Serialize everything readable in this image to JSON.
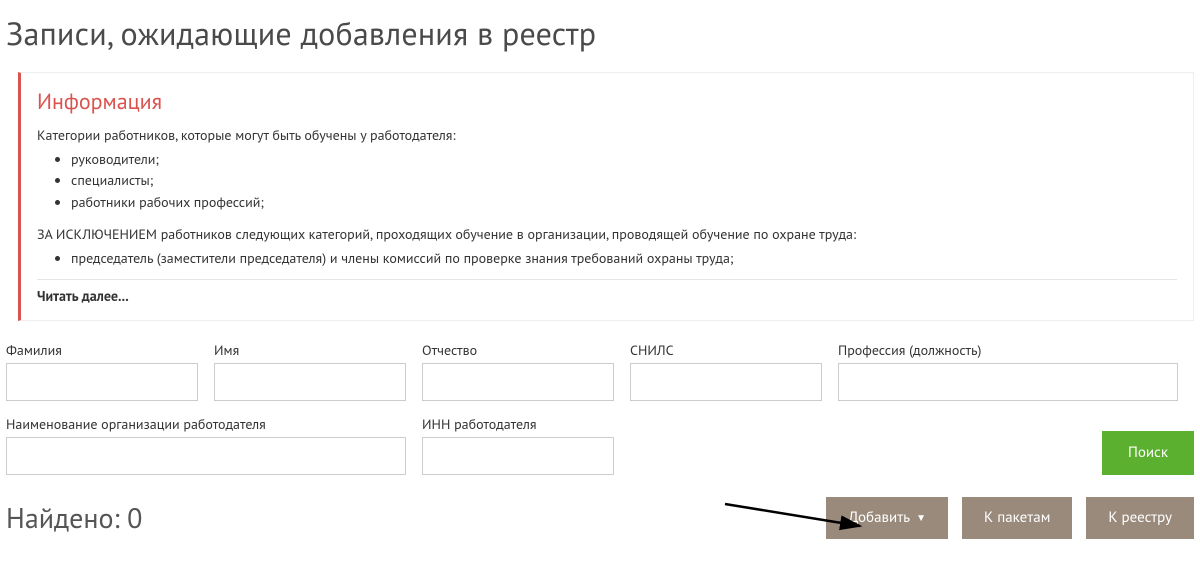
{
  "page": {
    "title": "Записи, ожидающие добавления в реестр"
  },
  "info": {
    "heading": "Информация",
    "intro": "Категории работников, которые могут быть обучены у работодателя:",
    "categories": [
      "руководители;",
      "специалисты;",
      "работники рабочих профессий;"
    ],
    "exception_intro": "ЗА ИСКЛЮЧЕНИЕМ работников следующих категорий, проходящих обучение в организации, проводящей обучение по охране труда:",
    "exceptions": [
      "председатель (заместители председателя) и члены комиссий по проверке знания требований охраны труда;"
    ],
    "read_more": "Читать далее..."
  },
  "filters": {
    "surname_label": "Фамилия",
    "name_label": "Имя",
    "patronymic_label": "Отчество",
    "snils_label": "СНИЛС",
    "position_label": "Профессия (должность)",
    "employer_org_label": "Наименование организации работодателя",
    "employer_inn_label": "ИНН работодателя",
    "search_label": "Поиск"
  },
  "results": {
    "found_prefix": "Найдено: ",
    "found_count": "0"
  },
  "actions": {
    "add_label": "Добавить",
    "to_packages_label": "К пакетам",
    "to_registry_label": "К реестру"
  }
}
